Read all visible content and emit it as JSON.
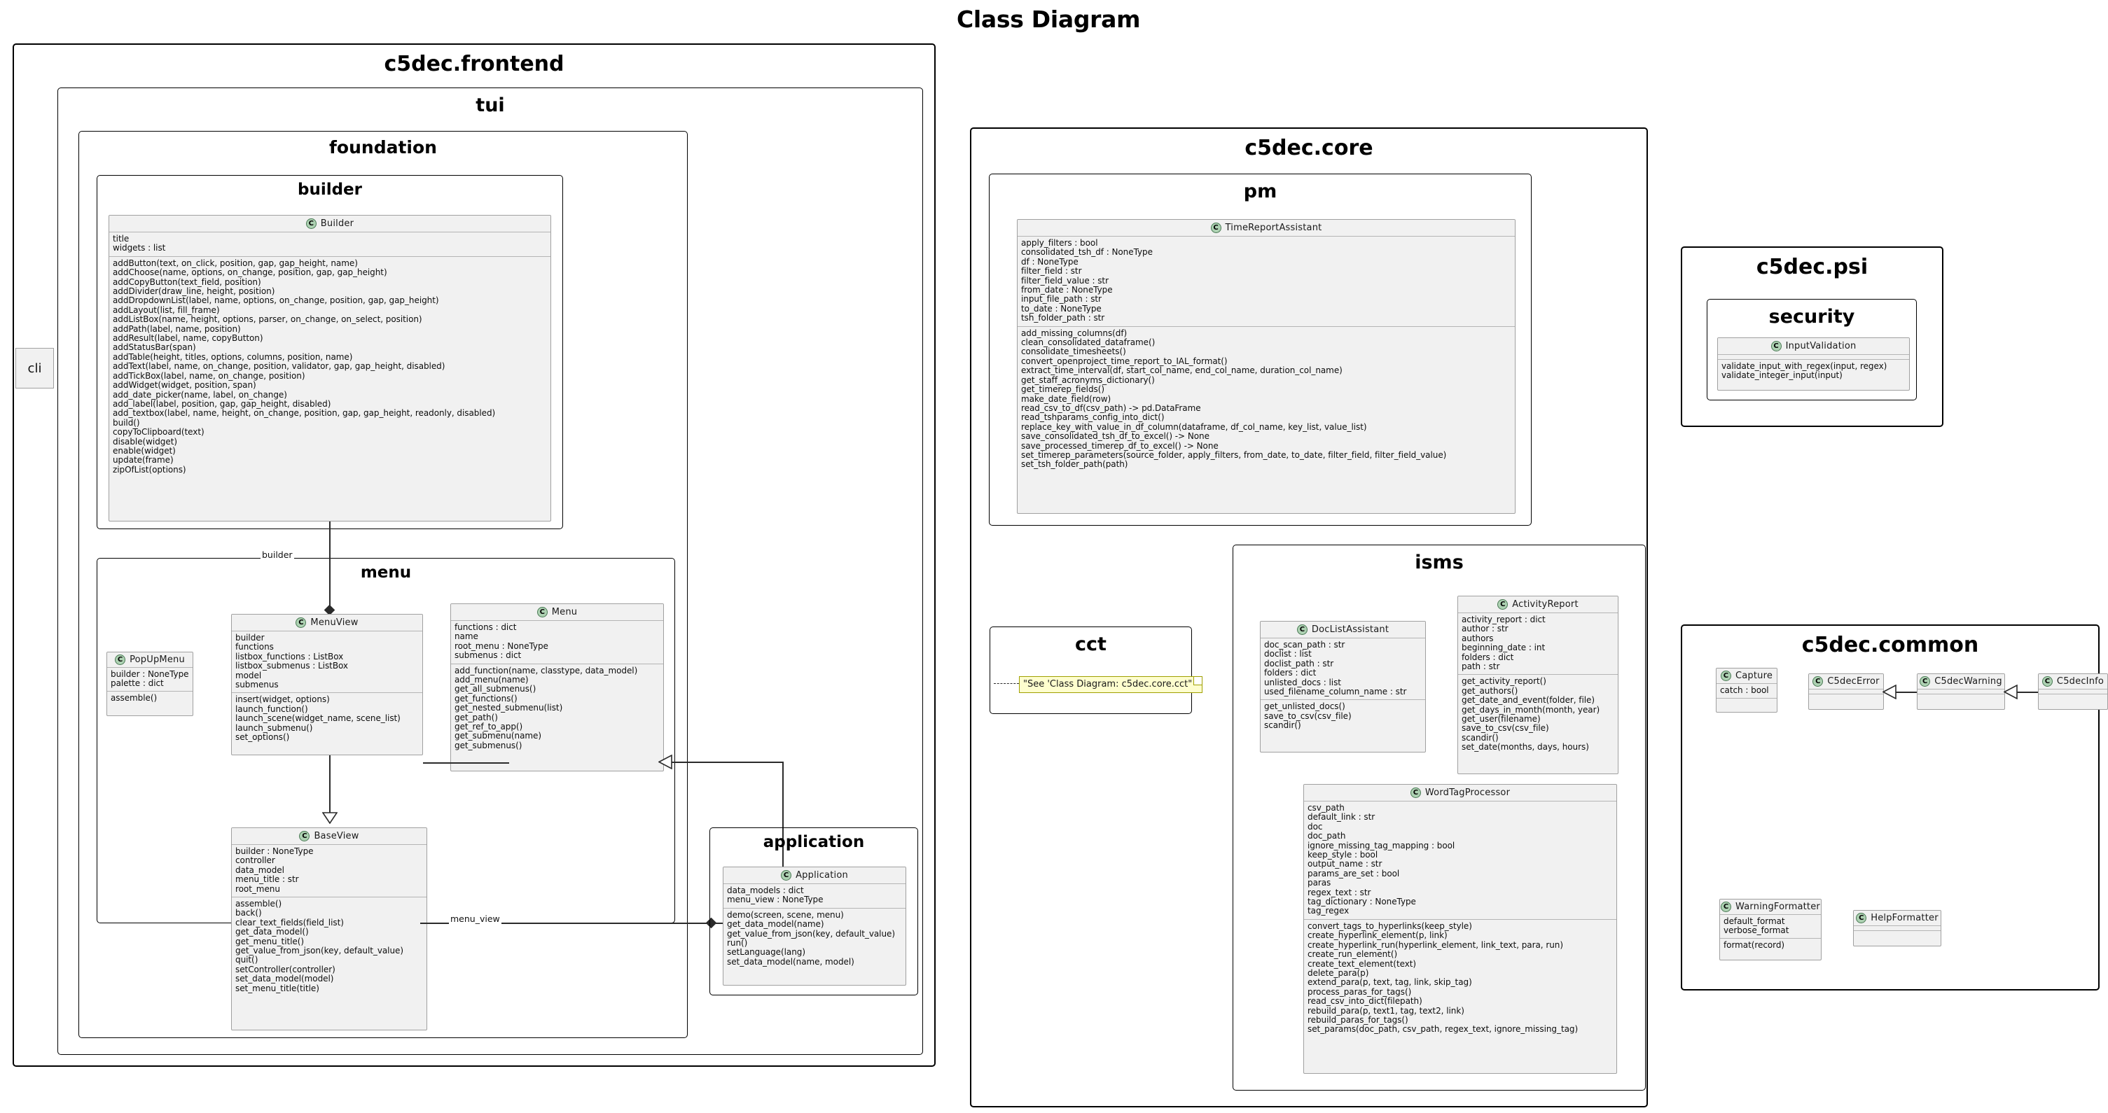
{
  "diagram": {
    "title": "Class Diagram",
    "stereotype_glyph": "C"
  },
  "standalone": {
    "cli_label": "cli"
  },
  "packages": {
    "frontend": {
      "title": "c5dec.frontend",
      "tui": {
        "title": "tui",
        "foundation": {
          "title": "foundation",
          "builder": {
            "title": "builder"
          },
          "menu": {
            "title": "menu"
          },
          "application": {
            "title": "application"
          }
        }
      }
    },
    "core": {
      "title": "c5dec.core",
      "pm": {
        "title": "pm"
      },
      "cct": {
        "title": "cct",
        "note": "\"See 'Class Diagram: c5dec.core.cct\""
      },
      "isms": {
        "title": "isms"
      }
    },
    "psi": {
      "title": "c5dec.psi",
      "security": {
        "title": "security"
      }
    },
    "common": {
      "title": "c5dec.common"
    }
  },
  "edges": {
    "builder_label": "builder",
    "menu_view_label": "menu_view"
  },
  "classes": {
    "builder_cls": {
      "name": "Builder",
      "attributes": [
        "title",
        "widgets : list"
      ],
      "methods": [
        "addButton(text, on_click, position, gap, gap_height, name)",
        "addChoose(name, options, on_change, position, gap, gap_height)",
        "addCopyButton(text_field, position)",
        "addDivider(draw_line, height, position)",
        "addDropdownList(label, name, options, on_change, position, gap, gap_height)",
        "addLayout(list, fill_frame)",
        "addListBox(name, height, options, parser, on_change, on_select, position)",
        "addPath(label, name, position)",
        "addResult(label, name, copyButton)",
        "addStatusBar(span)",
        "addTable(height, titles, options, columns, position, name)",
        "addText(label, name, on_change, position, validator, gap, gap_height, disabled)",
        "addTickBox(label, name, on_change, position)",
        "addWidget(widget, position, span)",
        "add_date_picker(name, label, on_change)",
        "add_label(label, position, gap, gap_height, disabled)",
        "add_textbox(label, name, height, on_change, position, gap, gap_height, readonly, disabled)",
        "build()",
        "copyToClipboard(text)",
        "disable(widget)",
        "enable(widget)",
        "update(frame)",
        "zipOfList(options)"
      ]
    },
    "popupmenu": {
      "name": "PopUpMenu",
      "attributes": [
        "builder : NoneType",
        "palette : dict"
      ],
      "methods": [
        "assemble()"
      ]
    },
    "menuview": {
      "name": "MenuView",
      "attributes": [
        "builder",
        "functions",
        "listbox_functions : ListBox",
        "listbox_submenus : ListBox",
        "model",
        "submenus"
      ],
      "methods": [
        "insert(widget, options)",
        "launch_function()",
        "launch_scene(widget_name, scene_list)",
        "launch_submenu()",
        "set_options()"
      ]
    },
    "menu_cls": {
      "name": "Menu",
      "attributes": [
        "functions : dict",
        "name",
        "root_menu : NoneType",
        "submenus : dict"
      ],
      "methods": [
        "add_function(name, classtype, data_model)",
        "add_menu(name)",
        "get_all_submenus()",
        "get_functions()",
        "get_nested_submenu(list)",
        "get_path()",
        "get_ref_to_app()",
        "get_submenu(name)",
        "get_submenus()"
      ]
    },
    "baseview": {
      "name": "BaseView",
      "attributes": [
        "builder : NoneType",
        "controller",
        "data_model",
        "menu_title : str",
        "root_menu"
      ],
      "methods": [
        "assemble()",
        "back()",
        "clear_text_fields(field_list)",
        "get_data_model()",
        "get_menu_title()",
        "get_value_from_json(key, default_value)",
        "quit()",
        "setController(controller)",
        "set_data_model(model)",
        "set_menu_title(title)"
      ]
    },
    "application_cls": {
      "name": "Application",
      "attributes": [
        "data_models : dict",
        "menu_view : NoneType"
      ],
      "methods": [
        "demo(screen, scene, menu)",
        "get_data_model(name)",
        "get_value_from_json(key, default_value)",
        "run()",
        "setLanguage(lang)",
        "set_data_model(name, model)"
      ]
    },
    "timereportassistant": {
      "name": "TimeReportAssistant",
      "attributes": [
        "apply_filters : bool",
        "consolidated_tsh_df : NoneType",
        "df : NoneType",
        "filter_field : str",
        "filter_field_value : str",
        "from_date : NoneType",
        "input_file_path : str",
        "to_date : NoneType",
        "tsh_folder_path : str"
      ],
      "methods": [
        "add_missing_columns(df)",
        "clean_consolidated_dataframe()",
        "consolidate_timesheets()",
        "convert_openproject_time_report_to_IAL_format()",
        "extract_time_interval(df, start_col_name, end_col_name, duration_col_name)",
        "get_staff_acronyms_dictionary()",
        "get_timerep_fields()",
        "make_date_field(row)",
        "read_csv_to_df(csv_path) -> pd.DataFrame",
        "read_tshparams_config_into_dict()",
        "replace_key_with_value_in_df_column(dataframe, df_col_name, key_list, value_list)",
        "save_consolidated_tsh_df_to_excel() -> None",
        "save_processed_timerep_df_to_excel() -> None",
        "set_timerep_parameters(source_folder, apply_filters, from_date, to_date, filter_field, filter_field_value)",
        "set_tsh_folder_path(path)"
      ]
    },
    "doclistassistant": {
      "name": "DocListAssistant",
      "attributes": [
        "doc_scan_path : str",
        "doclist : list",
        "doclist_path : str",
        "folders : dict",
        "unlisted_docs : list",
        "used_filename_column_name : str"
      ],
      "methods": [
        "get_unlisted_docs()",
        "save_to_csv(csv_file)",
        "scandir()"
      ]
    },
    "activityreport": {
      "name": "ActivityReport",
      "attributes": [
        "activity_report : dict",
        "author : str",
        "authors",
        "beginning_date : int",
        "folders : dict",
        "path : str"
      ],
      "methods": [
        "get_activity_report()",
        "get_authors()",
        "get_date_and_event(folder, file)",
        "get_days_in_month(month, year)",
        "get_user(filename)",
        "save_to_csv(csv_file)",
        "scandir()",
        "set_date(months, days, hours)"
      ]
    },
    "wordtagprocessor": {
      "name": "WordTagProcessor",
      "attributes": [
        "csv_path",
        "default_link : str",
        "doc",
        "doc_path",
        "ignore_missing_tag_mapping : bool",
        "keep_style : bool",
        "output_name : str",
        "params_are_set : bool",
        "paras",
        "regex_text : str",
        "tag_dictionary : NoneType",
        "tag_regex"
      ],
      "methods": [
        "convert_tags_to_hyperlinks(keep_style)",
        "create_hyperlink_element(p, link)",
        "create_hyperlink_run(hyperlink_element, link_text, para, run)",
        "create_run_element()",
        "create_text_element(text)",
        "delete_para(p)",
        "extend_para(p, text, tag, link, skip_tag)",
        "process_paras_for_tags()",
        "read_csv_into_dict(filepath)",
        "rebuild_para(p, text1, tag, text2, link)",
        "rebuild_paras_for_tags()",
        "set_params(doc_path, csv_path, regex_text, ignore_missing_tag)"
      ]
    },
    "inputvalidation": {
      "name": "InputValidation",
      "attributes": [],
      "methods": [
        "validate_input_with_regex(input, regex)",
        "validate_integer_input(input)"
      ]
    },
    "capture": {
      "name": "Capture",
      "attributes": [
        "catch : bool"
      ],
      "methods": []
    },
    "c5decerror": {
      "name": "C5decError",
      "attributes": [],
      "methods": []
    },
    "c5decwarning": {
      "name": "C5decWarning",
      "attributes": [],
      "methods": []
    },
    "c5decinfo": {
      "name": "C5decInfo",
      "attributes": [],
      "methods": []
    },
    "warningformatter": {
      "name": "WarningFormatter",
      "attributes": [
        "default_format",
        "verbose_format"
      ],
      "methods": [
        "format(record)"
      ]
    },
    "helpformatter": {
      "name": "HelpFormatter",
      "attributes": [],
      "methods": []
    }
  },
  "colors": {
    "class_fill": "#F1F1F1",
    "class_border": "#A0A0A0",
    "stereotype_fill": "#ADD1B2",
    "note_fill": "#FEFECE",
    "note_border": "#A0A000",
    "line": "#2B2B2B",
    "text": "#0D0D0D"
  }
}
